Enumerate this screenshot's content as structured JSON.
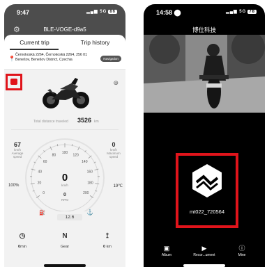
{
  "left": {
    "status": {
      "time": "9:47",
      "network": "5G",
      "battery": "86"
    },
    "device_name": "BLE-VOGE-d9a5",
    "tabs": [
      {
        "label": "Current trip"
      },
      {
        "label": "Trip history"
      }
    ],
    "address": "Černokoská 2264, Černokoská 2264, 256 01 Benešov, Benešov District, Czechia",
    "navigation_button": "Navigation",
    "total_distance_label": "Total distance traveled",
    "total_distance_value": "3526",
    "total_distance_unit": "km",
    "average_speed": {
      "value": "67",
      "unit": "km/h",
      "label": "Average speed"
    },
    "maximum_speed": {
      "value": "0",
      "unit": "km/h",
      "label": "Maximum speed"
    },
    "gauge": {
      "ticks": [
        "0",
        "20",
        "40",
        "60",
        "80",
        "100",
        "120",
        "140",
        "160",
        "180",
        "200"
      ],
      "speed": "0",
      "speed_unit": "km/h",
      "rpm": "0",
      "rpm_unit": "RPM"
    },
    "battery_percent": "100%",
    "temperature": "19℃",
    "odometer": "12.6",
    "bottom": [
      {
        "value": "0",
        "unit": "min",
        "icon": "clock-icon"
      },
      {
        "value": "N",
        "unit": "Gear",
        "icon": "gear-letter"
      },
      {
        "value": "0",
        "unit": "km",
        "icon": "route-icon"
      }
    ]
  },
  "right": {
    "status": {
      "time": "14:58",
      "network": "5G",
      "battery": "78"
    },
    "title": "博仕科技",
    "device_label": "mt022_720564",
    "bottom_nav": [
      {
        "label": "Album",
        "icon": "album-icon"
      },
      {
        "label": "Recor...ument",
        "icon": "record-icon"
      },
      {
        "label": "Mine",
        "icon": "info-icon"
      }
    ]
  },
  "colors": {
    "highlight": "#e0141b",
    "header": "#4d4d4d"
  }
}
